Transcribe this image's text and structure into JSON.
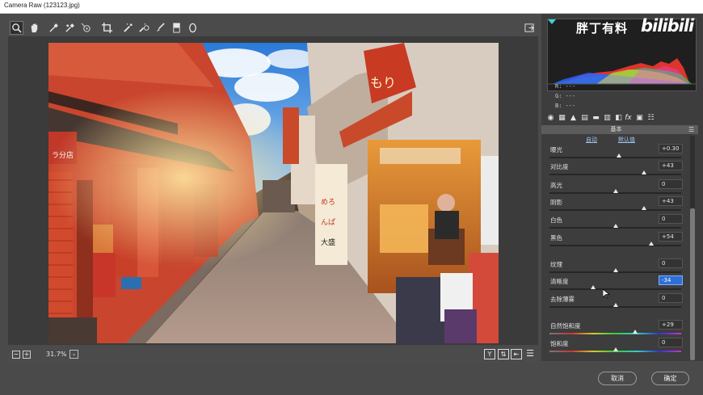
{
  "window": {
    "title": "Camera Raw (123123.jpg)"
  },
  "toolbar": {
    "tools": [
      {
        "id": "zoom",
        "icon": "zoom-icon",
        "active": true
      },
      {
        "id": "hand",
        "icon": "hand-icon"
      },
      {
        "id": "white-balance",
        "icon": "eyedropper-icon"
      },
      {
        "id": "color-sampler",
        "icon": "color-sampler-icon"
      },
      {
        "id": "target-adjust",
        "icon": "target-adjust-icon"
      },
      {
        "id": "crop",
        "icon": "crop-icon"
      },
      {
        "id": "spot-removal",
        "icon": "spot-removal-icon"
      },
      {
        "id": "red-eye",
        "icon": "red-eye-icon"
      },
      {
        "id": "adjust-brush",
        "icon": "brush-icon"
      },
      {
        "id": "grad-filter",
        "icon": "graduated-filter-icon"
      },
      {
        "id": "radial-filter",
        "icon": "radial-filter-icon"
      }
    ],
    "open_prefs_icon": "open-in-new-icon"
  },
  "statusbar": {
    "zoom": "31.7%"
  },
  "watermark": {
    "channel": "胖丁有料",
    "logo": "bilibili"
  },
  "histogram_readout": {
    "r": "R:   ---",
    "g": "G:   ---",
    "b": "B:   ---"
  },
  "panel": {
    "title": "基本",
    "auto_label": "自动",
    "default_label": "默认值",
    "sliders": [
      {
        "label": "曝光",
        "value": "+0.30",
        "pos": 0.53
      },
      {
        "label": "对比度",
        "value": "+43",
        "pos": 0.72
      },
      {
        "label": "高光",
        "value": "0",
        "pos": 0.5
      },
      {
        "label": "阴影",
        "value": "+43",
        "pos": 0.72
      },
      {
        "label": "白色",
        "value": "0",
        "pos": 0.5
      },
      {
        "label": "黑色",
        "value": "+54",
        "pos": 0.77
      },
      {
        "label": "纹理",
        "value": "0",
        "pos": 0.5
      },
      {
        "label": "清晰度",
        "value": "-34",
        "pos": 0.33,
        "active": true
      },
      {
        "label": "去除薄雾",
        "value": "0",
        "pos": 0.5
      },
      {
        "label": "自然饱和度",
        "value": "+29",
        "pos": 0.65
      },
      {
        "label": "饱和度",
        "value": "0",
        "pos": 0.5
      }
    ]
  },
  "buttons": {
    "cancel": "取消",
    "ok": "确定"
  },
  "colors": {
    "accent": "#2e6fd6",
    "link": "#9fc6ee"
  }
}
